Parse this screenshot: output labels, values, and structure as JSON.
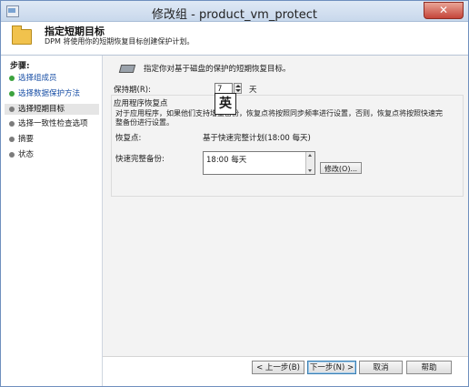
{
  "window": {
    "title": "修改组 - product_vm_protect",
    "close_label": "✕"
  },
  "header": {
    "title": "指定短期目标",
    "description": "DPM 将使用你的短期恢复目标创建保护计划。"
  },
  "sidebar": {
    "label": "步骤:",
    "items": [
      {
        "label": "选择组成员"
      },
      {
        "label": "选择数据保护方法"
      },
      {
        "label": "选择短期目标"
      },
      {
        "label": "选择一致性检查选项"
      },
      {
        "label": "摘要"
      },
      {
        "label": "状态"
      }
    ]
  },
  "main": {
    "intro": "指定你对基于磁盘的保护的短期恢复目标。",
    "retention_label": "保持期(R):",
    "retention_value": "7",
    "retention_unit": "天",
    "ime_indicator": "英",
    "group_title": "应用程序恢复点",
    "group_description": "对于应用程序，如果他们支持增量备份，恢复点将按照同步频率进行设置，否则，恢复点将按照快速完整备份进行设置。",
    "recovery_point_label": "恢复点:",
    "recovery_point_value": "基于快速完整计划(18:00 每天)",
    "backup_label": "快速完整备份:",
    "backup_schedule": "18:00 每天",
    "modify_button": "修改(O)..."
  },
  "footer": {
    "back": "< 上一步(B)",
    "next": "下一步(N) >",
    "cancel": "取消",
    "help": "帮助"
  }
}
